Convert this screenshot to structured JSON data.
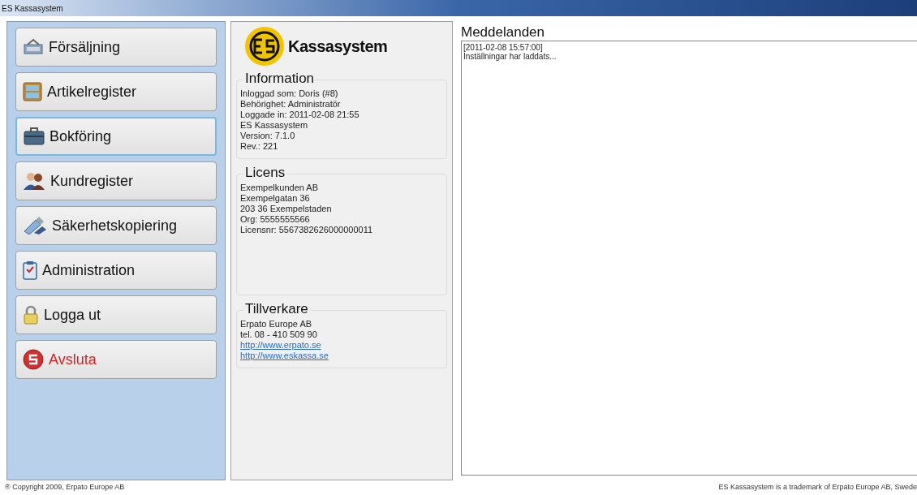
{
  "window": {
    "title": "ES Kassasystem"
  },
  "menu": [
    {
      "label": "Försäljning",
      "kind": "sales",
      "selected": false
    },
    {
      "label": "Artikelregister",
      "kind": "articles",
      "selected": false
    },
    {
      "label": "Bokföring",
      "kind": "accounting",
      "selected": true
    },
    {
      "label": "Kundregister",
      "kind": "customers",
      "selected": false
    },
    {
      "label": "Säkerhetskopiering",
      "kind": "backup",
      "selected": false
    },
    {
      "label": "Administration",
      "kind": "admin",
      "selected": false
    },
    {
      "label": "Logga ut",
      "kind": "logout",
      "selected": false
    },
    {
      "label": "Avsluta",
      "kind": "exit",
      "selected": false
    }
  ],
  "logo": {
    "text": "Kassasystem"
  },
  "groups": [
    {
      "title": "Information",
      "lines": [
        {
          "text": "Inloggad som: Doris (#8)"
        },
        {
          "text": "Behörighet: Administratör"
        },
        {
          "text": "Loggade in: 2011-02-08 21:55"
        },
        {
          "text": "ES Kassasystem"
        },
        {
          "text": "Version: 7.1.0"
        },
        {
          "text": "Rev.: 221"
        }
      ]
    },
    {
      "title": "Licens",
      "lines": [
        {
          "text": "Exempelkunden AB"
        },
        {
          "text": "Exempelgatan 36"
        },
        {
          "text": "203 36   Exempelstaden"
        },
        {
          "text": "Org: 5555555566"
        },
        {
          "text": "Licensnr: 5567382626000000011"
        }
      ]
    },
    {
      "title": "Tillverkare",
      "lines": [
        {
          "text": "Erpato Europe AB"
        },
        {
          "text": "tel. 08 - 410 509 90"
        },
        {
          "text": "http://www.erpato.se",
          "kind": "link"
        },
        {
          "text": "http://www.eskassa.se",
          "kind": "link"
        }
      ]
    }
  ],
  "messages": {
    "title": "Meddelanden",
    "lines": [
      "[2011-02-08 15:57:00]",
      "Inställningar har laddats..."
    ]
  },
  "status_bar": {
    "left": "® Copyright 2009, Erpato Europe AB",
    "right": "ES Kassasystem is a trademark of Erpato Europe AB, Swede"
  }
}
